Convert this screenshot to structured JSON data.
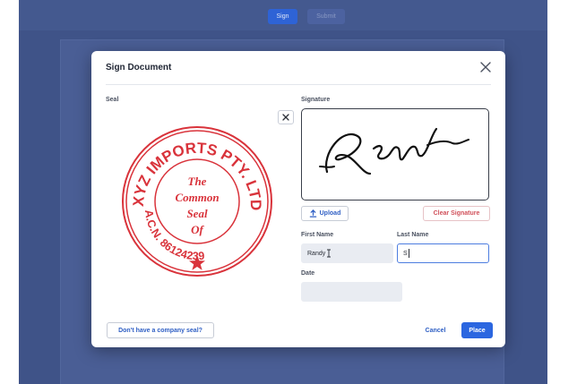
{
  "toolbar": {
    "sign_tab": "Sign",
    "submit_tab": "Submit"
  },
  "modal": {
    "title": "Sign Document",
    "close_icon": "close-icon",
    "seal_label": "Seal",
    "signature_label": "Signature",
    "upload_label": "Upload",
    "clear_signature_label": "Clear Signature",
    "first_name_label": "First Name",
    "last_name_label": "Last Name",
    "date_label": "Date",
    "no_seal_label": "Don't have a company seal?",
    "cancel_label": "Cancel",
    "place_label": "Place"
  },
  "form": {
    "first_name_value": "Randy",
    "last_name_value": "S",
    "date_value": ""
  },
  "seal": {
    "outer_text": "XYZ IMPORTS PTY. LTD.",
    "acn_text": "A.C.N. 86124239",
    "line1": "The",
    "line2": "Common",
    "line3": "Seal",
    "line4": "Of"
  },
  "colors": {
    "accent": "#2b66e0",
    "seal_red": "#d9333b",
    "danger": "#d0505a",
    "backdrop": "#3f5388"
  }
}
